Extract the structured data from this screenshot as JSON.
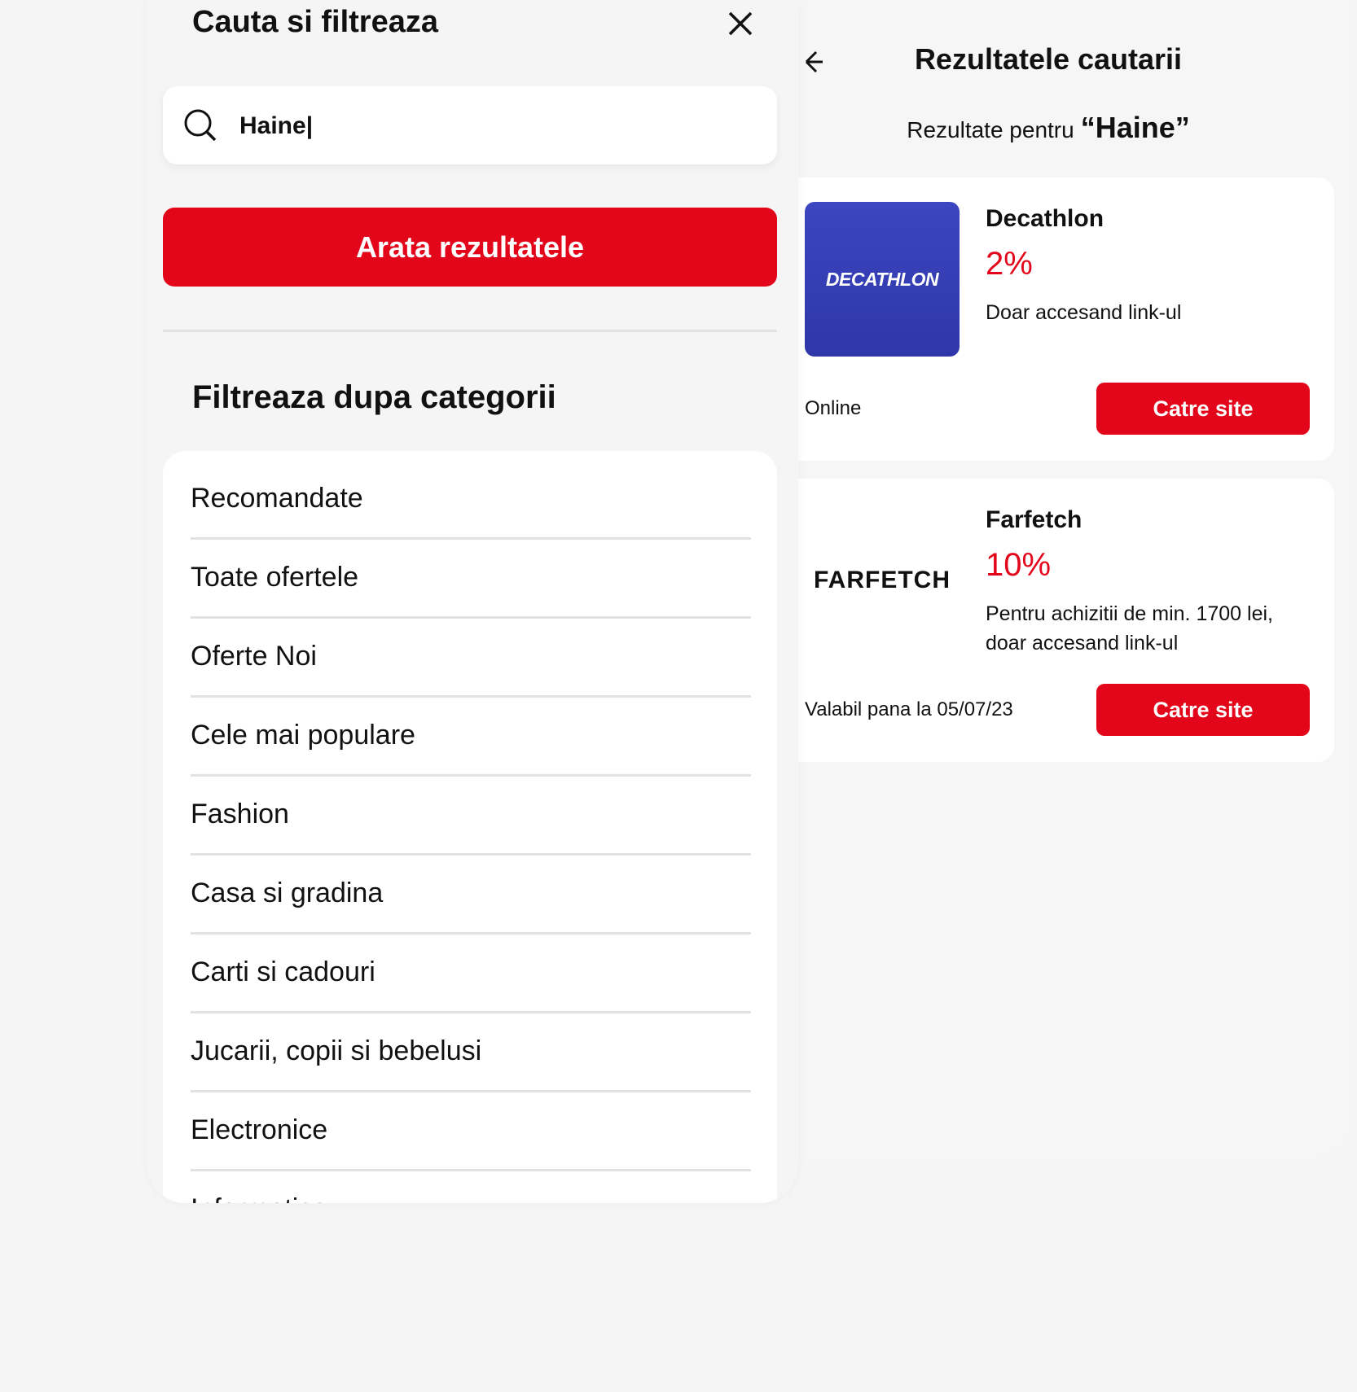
{
  "results": {
    "title": "Rezultatele cautarii",
    "results_for_label": "Rezultate pentru",
    "query_display": "“Haine”",
    "offers": [
      {
        "brand": "Decathlon",
        "logo_text": "DECATHLON",
        "discount": "2%",
        "description": "Doar accesand link-ul",
        "meta": "Online",
        "button_label": "Catre site"
      },
      {
        "brand": "Farfetch",
        "logo_text": "FARFETCH",
        "discount": "10%",
        "description": "Pentru achizitii de min. 1700 lei, doar accesand link-ul",
        "meta": "Valabil pana la 05/07/23",
        "button_label": "Catre site"
      }
    ]
  },
  "filter": {
    "title": "Cauta si filtreaza",
    "search": {
      "value": "Haine|",
      "icon": "search-icon"
    },
    "show_results_label": "Arata rezultatele",
    "categories_heading": "Filtreaza dupa categorii",
    "categories": [
      "Recomandate",
      "Toate ofertele",
      "Oferte Noi",
      "Cele mai populare",
      "Fashion",
      "Casa si gradina",
      "Carti si cadouri",
      "Jucarii, copii si bebelusi",
      "Electronice",
      "Informatica"
    ]
  },
  "colors": {
    "accent": "#e3061b",
    "background": "#f5f5f5",
    "card": "#ffffff",
    "decathlon_blue": "#3640b8"
  }
}
